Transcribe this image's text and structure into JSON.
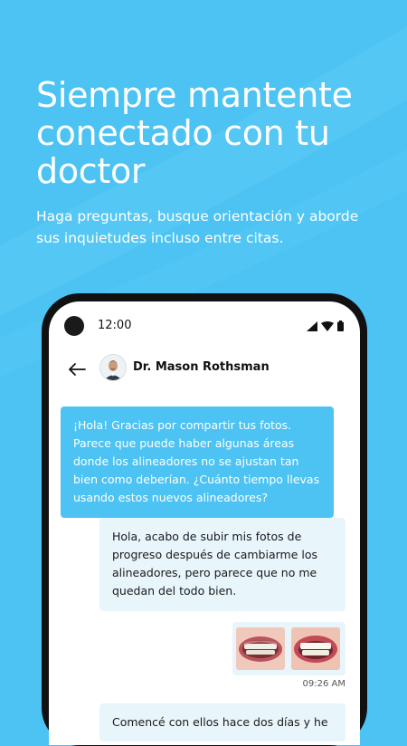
{
  "hero": {
    "title": "Siempre mantente conectado con tu doctor",
    "subtitle": "Haga preguntas, busque orientación y aborde sus inquietudes incluso entre citas."
  },
  "status_bar": {
    "time": "12:00",
    "icons": [
      "signal-icon",
      "wifi-icon",
      "battery-icon"
    ]
  },
  "chat_header": {
    "back_icon": "arrow-left-icon",
    "doctor_name": "Dr. Mason Rothsman"
  },
  "messages": [
    {
      "direction": "incoming",
      "text": "¡Hola! Gracias por compartir tus fotos. Parece que puede haber algunas áreas donde los alineadores no se ajustan tan bien como deberían. ¿Cuánto tiempo llevas usando estos nuevos alineadores?"
    },
    {
      "direction": "outgoing",
      "text": "Hola, acabo de subir mis fotos de progreso después de cambiarme los alineadores, pero parece que no me quedan del todo bien."
    },
    {
      "direction": "outgoing",
      "type": "photos",
      "time": "09:26 AM"
    },
    {
      "direction": "outgoing",
      "text": "Comencé con ellos hace dos días y he"
    }
  ],
  "colors": {
    "brand_blue": "#4cc3f3",
    "outgoing_bubble": "#e8f5fa",
    "phone_frame": "#111111"
  }
}
